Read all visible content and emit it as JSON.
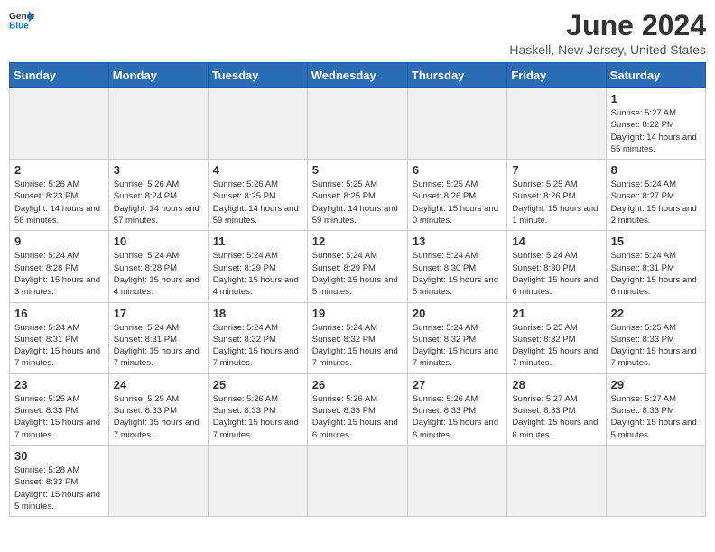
{
  "header": {
    "logo_general": "General",
    "logo_blue": "Blue",
    "title": "June 2024",
    "subtitle": "Haskell, New Jersey, United States"
  },
  "weekdays": [
    "Sunday",
    "Monday",
    "Tuesday",
    "Wednesday",
    "Thursday",
    "Friday",
    "Saturday"
  ],
  "weeks": [
    [
      {
        "day": "",
        "info": ""
      },
      {
        "day": "",
        "info": ""
      },
      {
        "day": "",
        "info": ""
      },
      {
        "day": "",
        "info": ""
      },
      {
        "day": "",
        "info": ""
      },
      {
        "day": "",
        "info": ""
      },
      {
        "day": "1",
        "info": "Sunrise: 5:27 AM\nSunset: 8:22 PM\nDaylight: 14 hours and 55 minutes."
      }
    ],
    [
      {
        "day": "2",
        "info": "Sunrise: 5:26 AM\nSunset: 8:23 PM\nDaylight: 14 hours and 56 minutes."
      },
      {
        "day": "3",
        "info": "Sunrise: 5:26 AM\nSunset: 8:24 PM\nDaylight: 14 hours and 57 minutes."
      },
      {
        "day": "4",
        "info": "Sunrise: 5:26 AM\nSunset: 8:25 PM\nDaylight: 14 hours and 59 minutes."
      },
      {
        "day": "5",
        "info": "Sunrise: 5:25 AM\nSunset: 8:25 PM\nDaylight: 14 hours and 59 minutes."
      },
      {
        "day": "6",
        "info": "Sunrise: 5:25 AM\nSunset: 8:26 PM\nDaylight: 15 hours and 0 minutes."
      },
      {
        "day": "7",
        "info": "Sunrise: 5:25 AM\nSunset: 8:26 PM\nDaylight: 15 hours and 1 minute."
      },
      {
        "day": "8",
        "info": "Sunrise: 5:24 AM\nSunset: 8:27 PM\nDaylight: 15 hours and 2 minutes."
      }
    ],
    [
      {
        "day": "9",
        "info": "Sunrise: 5:24 AM\nSunset: 8:28 PM\nDaylight: 15 hours and 3 minutes."
      },
      {
        "day": "10",
        "info": "Sunrise: 5:24 AM\nSunset: 8:28 PM\nDaylight: 15 hours and 4 minutes."
      },
      {
        "day": "11",
        "info": "Sunrise: 5:24 AM\nSunset: 8:29 PM\nDaylight: 15 hours and 4 minutes."
      },
      {
        "day": "12",
        "info": "Sunrise: 5:24 AM\nSunset: 8:29 PM\nDaylight: 15 hours and 5 minutes."
      },
      {
        "day": "13",
        "info": "Sunrise: 5:24 AM\nSunset: 8:30 PM\nDaylight: 15 hours and 5 minutes."
      },
      {
        "day": "14",
        "info": "Sunrise: 5:24 AM\nSunset: 8:30 PM\nDaylight: 15 hours and 6 minutes."
      },
      {
        "day": "15",
        "info": "Sunrise: 5:24 AM\nSunset: 8:31 PM\nDaylight: 15 hours and 6 minutes."
      }
    ],
    [
      {
        "day": "16",
        "info": "Sunrise: 5:24 AM\nSunset: 8:31 PM\nDaylight: 15 hours and 7 minutes."
      },
      {
        "day": "17",
        "info": "Sunrise: 5:24 AM\nSunset: 8:31 PM\nDaylight: 15 hours and 7 minutes."
      },
      {
        "day": "18",
        "info": "Sunrise: 5:24 AM\nSunset: 8:32 PM\nDaylight: 15 hours and 7 minutes."
      },
      {
        "day": "19",
        "info": "Sunrise: 5:24 AM\nSunset: 8:32 PM\nDaylight: 15 hours and 7 minutes."
      },
      {
        "day": "20",
        "info": "Sunrise: 5:24 AM\nSunset: 8:32 PM\nDaylight: 15 hours and 7 minutes."
      },
      {
        "day": "21",
        "info": "Sunrise: 5:25 AM\nSunset: 8:32 PM\nDaylight: 15 hours and 7 minutes."
      },
      {
        "day": "22",
        "info": "Sunrise: 5:25 AM\nSunset: 8:33 PM\nDaylight: 15 hours and 7 minutes."
      }
    ],
    [
      {
        "day": "23",
        "info": "Sunrise: 5:25 AM\nSunset: 8:33 PM\nDaylight: 15 hours and 7 minutes."
      },
      {
        "day": "24",
        "info": "Sunrise: 5:25 AM\nSunset: 8:33 PM\nDaylight: 15 hours and 7 minutes."
      },
      {
        "day": "25",
        "info": "Sunrise: 5:26 AM\nSunset: 8:33 PM\nDaylight: 15 hours and 7 minutes."
      },
      {
        "day": "26",
        "info": "Sunrise: 5:26 AM\nSunset: 8:33 PM\nDaylight: 15 hours and 6 minutes."
      },
      {
        "day": "27",
        "info": "Sunrise: 5:26 AM\nSunset: 8:33 PM\nDaylight: 15 hours and 6 minutes."
      },
      {
        "day": "28",
        "info": "Sunrise: 5:27 AM\nSunset: 8:33 PM\nDaylight: 15 hours and 6 minutes."
      },
      {
        "day": "29",
        "info": "Sunrise: 5:27 AM\nSunset: 8:33 PM\nDaylight: 15 hours and 5 minutes."
      }
    ],
    [
      {
        "day": "30",
        "info": "Sunrise: 5:28 AM\nSunset: 8:33 PM\nDaylight: 15 hours and 5 minutes."
      },
      {
        "day": "",
        "info": ""
      },
      {
        "day": "",
        "info": ""
      },
      {
        "day": "",
        "info": ""
      },
      {
        "day": "",
        "info": ""
      },
      {
        "day": "",
        "info": ""
      },
      {
        "day": "",
        "info": ""
      }
    ]
  ]
}
